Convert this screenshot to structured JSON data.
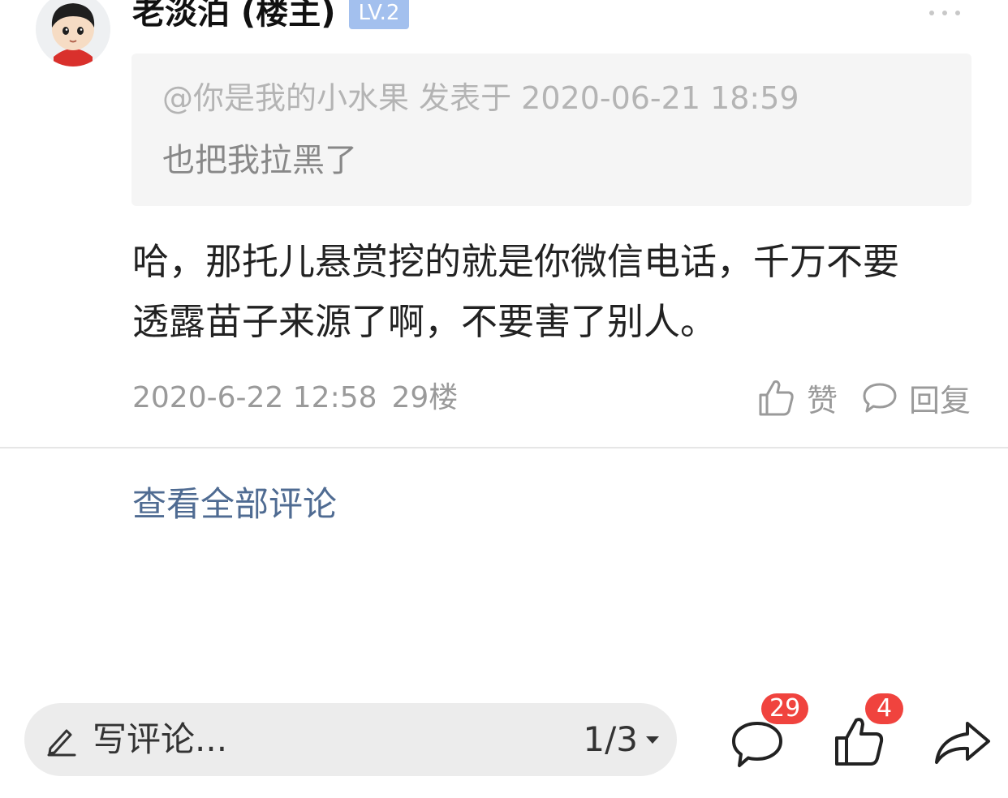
{
  "post": {
    "author_name": "老淡泊 (楼主)",
    "level_badge": "LV.2",
    "quote": {
      "meta": "@你是我的小水果 发表于 2020-06-21 18:59",
      "text": "也把我拉黑了"
    },
    "body_lines": [
      "哈，那托儿悬赏挖的就是你微信电话，千万不要",
      "透露苗子来源了啊，不要害了别人。"
    ],
    "timestamp": "2020-6-22 12:58",
    "floor": "29楼",
    "like_label": "赞",
    "reply_label": "回复"
  },
  "view_all_label": "查看全部评论",
  "bottom_bar": {
    "input_placeholder": "写评论...",
    "page_indicator": "1/3",
    "comment_count": "29",
    "like_count": "4"
  },
  "colors": {
    "level_badge": "#a3c0ee",
    "link": "#4f6b92",
    "count_badge": "#f0433e",
    "quote_background": "#f5f5f5"
  },
  "icons": [
    "avatar",
    "more-dots-icon",
    "thumbs-up-icon",
    "comment-bubble-icon",
    "pencil-icon",
    "dropdown-caret-icon",
    "share-arrow-icon"
  ]
}
